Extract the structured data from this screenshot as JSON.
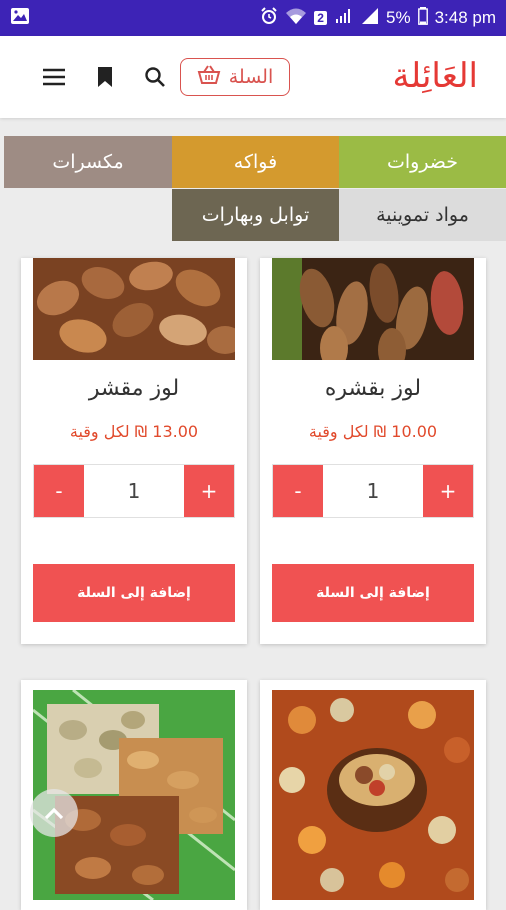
{
  "status_bar": {
    "battery": "5%",
    "time": "3:48 pm",
    "sim": "2"
  },
  "header": {
    "logo": "العَائِلة",
    "cart_label": "السلة"
  },
  "categories": [
    {
      "label": "خضروات",
      "color": "#9bbb45"
    },
    {
      "label": "فواكه",
      "color": "#d49a2e"
    },
    {
      "label": "مكسرات",
      "color": "#9e8c84"
    },
    {
      "label": "مواد تموينية",
      "color": "#dcdcdc"
    },
    {
      "label": "توابل وبهارات",
      "color": "#6d6652"
    }
  ],
  "products": [
    {
      "name": "لوز بقشره",
      "price": "10.00 ₪ لكل وقية",
      "qty": "1",
      "minus": "-",
      "plus": "+",
      "add_label": "إضافة إلى السلة"
    },
    {
      "name": "لوز مقشر",
      "price": "13.00 ₪ لكل وقية",
      "qty": "1",
      "minus": "-",
      "plus": "+",
      "add_label": "إضافة إلى السلة"
    }
  ],
  "accent_color": "#f05252"
}
